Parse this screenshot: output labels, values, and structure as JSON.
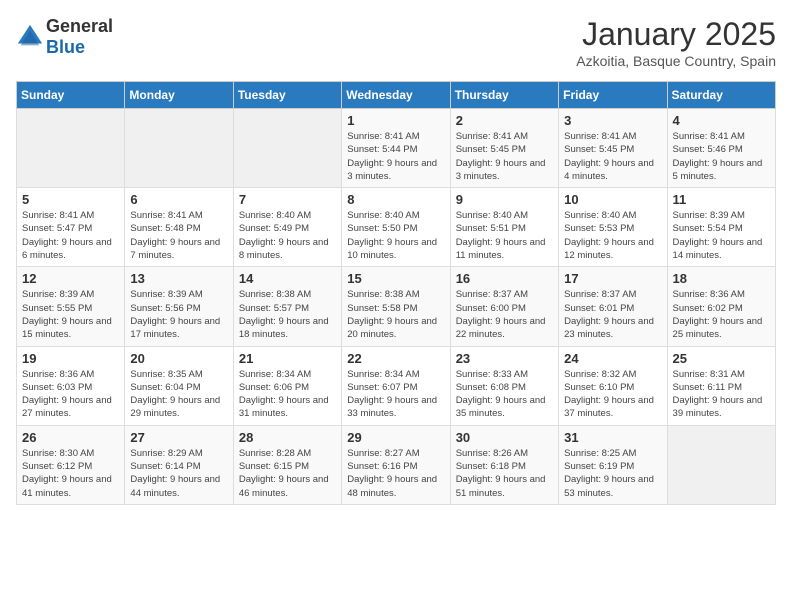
{
  "header": {
    "logo_general": "General",
    "logo_blue": "Blue",
    "month": "January 2025",
    "location": "Azkoitia, Basque Country, Spain"
  },
  "days_of_week": [
    "Sunday",
    "Monday",
    "Tuesday",
    "Wednesday",
    "Thursday",
    "Friday",
    "Saturday"
  ],
  "weeks": [
    [
      {
        "day": "",
        "info": ""
      },
      {
        "day": "",
        "info": ""
      },
      {
        "day": "",
        "info": ""
      },
      {
        "day": "1",
        "info": "Sunrise: 8:41 AM\nSunset: 5:44 PM\nDaylight: 9 hours and 3 minutes."
      },
      {
        "day": "2",
        "info": "Sunrise: 8:41 AM\nSunset: 5:45 PM\nDaylight: 9 hours and 3 minutes."
      },
      {
        "day": "3",
        "info": "Sunrise: 8:41 AM\nSunset: 5:45 PM\nDaylight: 9 hours and 4 minutes."
      },
      {
        "day": "4",
        "info": "Sunrise: 8:41 AM\nSunset: 5:46 PM\nDaylight: 9 hours and 5 minutes."
      }
    ],
    [
      {
        "day": "5",
        "info": "Sunrise: 8:41 AM\nSunset: 5:47 PM\nDaylight: 9 hours and 6 minutes."
      },
      {
        "day": "6",
        "info": "Sunrise: 8:41 AM\nSunset: 5:48 PM\nDaylight: 9 hours and 7 minutes."
      },
      {
        "day": "7",
        "info": "Sunrise: 8:40 AM\nSunset: 5:49 PM\nDaylight: 9 hours and 8 minutes."
      },
      {
        "day": "8",
        "info": "Sunrise: 8:40 AM\nSunset: 5:50 PM\nDaylight: 9 hours and 10 minutes."
      },
      {
        "day": "9",
        "info": "Sunrise: 8:40 AM\nSunset: 5:51 PM\nDaylight: 9 hours and 11 minutes."
      },
      {
        "day": "10",
        "info": "Sunrise: 8:40 AM\nSunset: 5:53 PM\nDaylight: 9 hours and 12 minutes."
      },
      {
        "day": "11",
        "info": "Sunrise: 8:39 AM\nSunset: 5:54 PM\nDaylight: 9 hours and 14 minutes."
      }
    ],
    [
      {
        "day": "12",
        "info": "Sunrise: 8:39 AM\nSunset: 5:55 PM\nDaylight: 9 hours and 15 minutes."
      },
      {
        "day": "13",
        "info": "Sunrise: 8:39 AM\nSunset: 5:56 PM\nDaylight: 9 hours and 17 minutes."
      },
      {
        "day": "14",
        "info": "Sunrise: 8:38 AM\nSunset: 5:57 PM\nDaylight: 9 hours and 18 minutes."
      },
      {
        "day": "15",
        "info": "Sunrise: 8:38 AM\nSunset: 5:58 PM\nDaylight: 9 hours and 20 minutes."
      },
      {
        "day": "16",
        "info": "Sunrise: 8:37 AM\nSunset: 6:00 PM\nDaylight: 9 hours and 22 minutes."
      },
      {
        "day": "17",
        "info": "Sunrise: 8:37 AM\nSunset: 6:01 PM\nDaylight: 9 hours and 23 minutes."
      },
      {
        "day": "18",
        "info": "Sunrise: 8:36 AM\nSunset: 6:02 PM\nDaylight: 9 hours and 25 minutes."
      }
    ],
    [
      {
        "day": "19",
        "info": "Sunrise: 8:36 AM\nSunset: 6:03 PM\nDaylight: 9 hours and 27 minutes."
      },
      {
        "day": "20",
        "info": "Sunrise: 8:35 AM\nSunset: 6:04 PM\nDaylight: 9 hours and 29 minutes."
      },
      {
        "day": "21",
        "info": "Sunrise: 8:34 AM\nSunset: 6:06 PM\nDaylight: 9 hours and 31 minutes."
      },
      {
        "day": "22",
        "info": "Sunrise: 8:34 AM\nSunset: 6:07 PM\nDaylight: 9 hours and 33 minutes."
      },
      {
        "day": "23",
        "info": "Sunrise: 8:33 AM\nSunset: 6:08 PM\nDaylight: 9 hours and 35 minutes."
      },
      {
        "day": "24",
        "info": "Sunrise: 8:32 AM\nSunset: 6:10 PM\nDaylight: 9 hours and 37 minutes."
      },
      {
        "day": "25",
        "info": "Sunrise: 8:31 AM\nSunset: 6:11 PM\nDaylight: 9 hours and 39 minutes."
      }
    ],
    [
      {
        "day": "26",
        "info": "Sunrise: 8:30 AM\nSunset: 6:12 PM\nDaylight: 9 hours and 41 minutes."
      },
      {
        "day": "27",
        "info": "Sunrise: 8:29 AM\nSunset: 6:14 PM\nDaylight: 9 hours and 44 minutes."
      },
      {
        "day": "28",
        "info": "Sunrise: 8:28 AM\nSunset: 6:15 PM\nDaylight: 9 hours and 46 minutes."
      },
      {
        "day": "29",
        "info": "Sunrise: 8:27 AM\nSunset: 6:16 PM\nDaylight: 9 hours and 48 minutes."
      },
      {
        "day": "30",
        "info": "Sunrise: 8:26 AM\nSunset: 6:18 PM\nDaylight: 9 hours and 51 minutes."
      },
      {
        "day": "31",
        "info": "Sunrise: 8:25 AM\nSunset: 6:19 PM\nDaylight: 9 hours and 53 minutes."
      },
      {
        "day": "",
        "info": ""
      }
    ]
  ]
}
